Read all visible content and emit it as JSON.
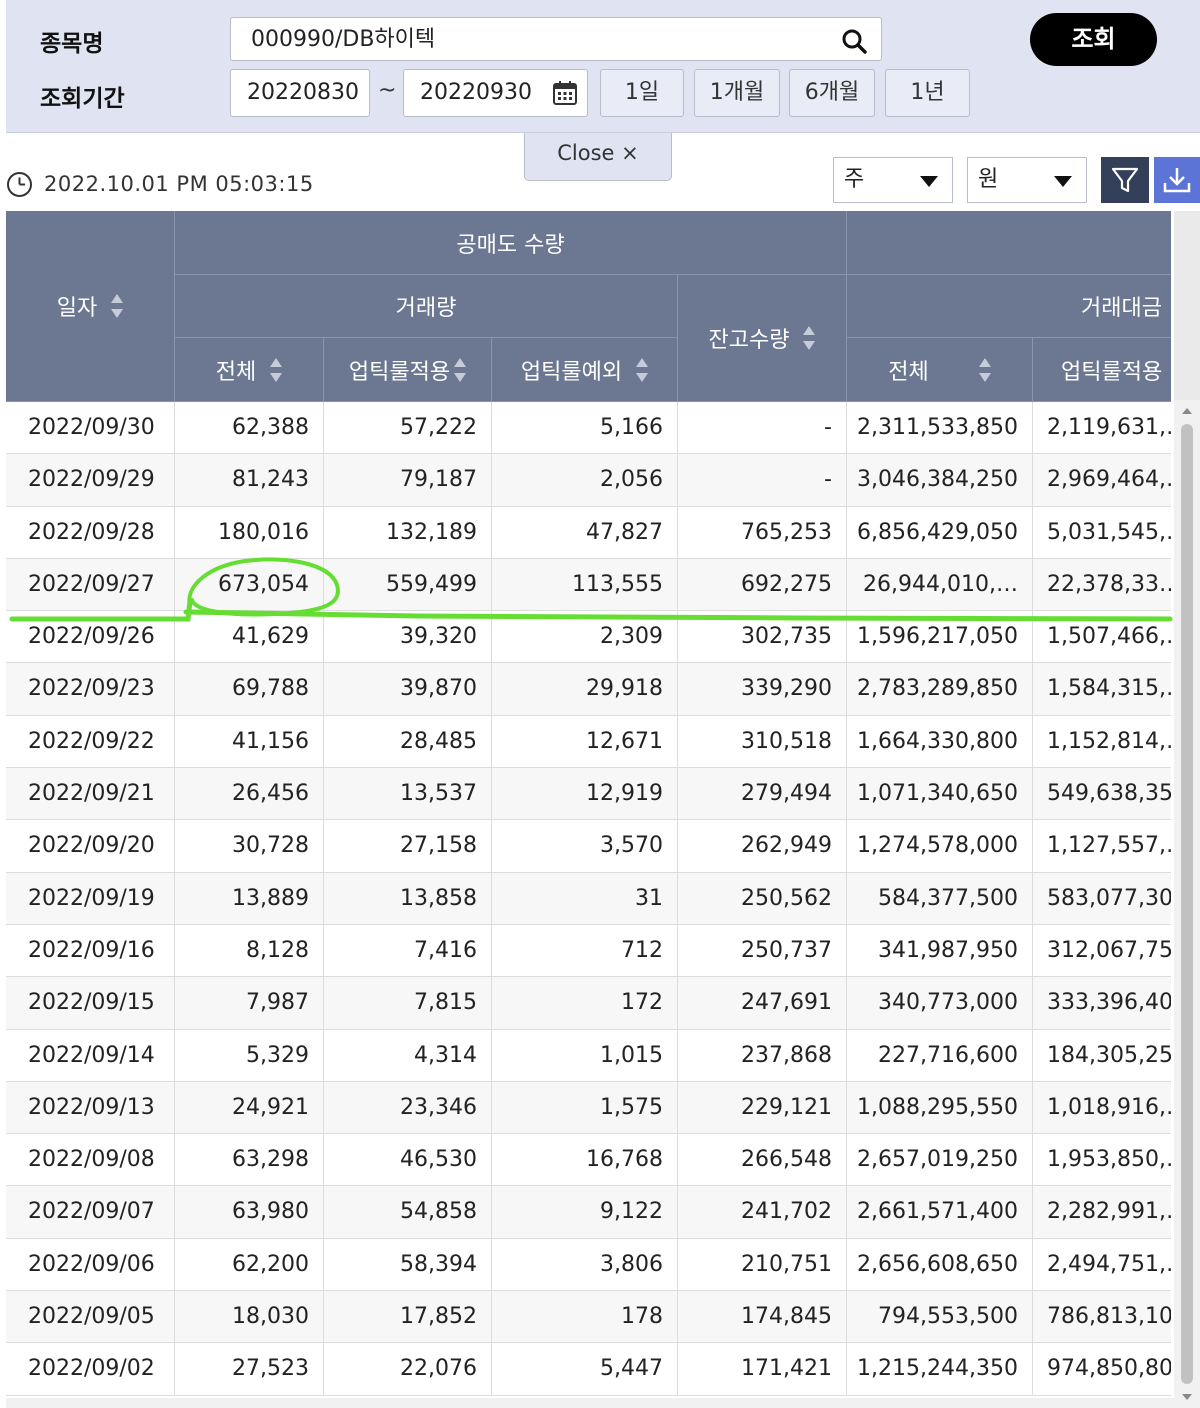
{
  "search": {
    "stock_label": "종목명",
    "period_label": "조회기간",
    "stock_value": "000990/DB하이텍",
    "date_from": "20220830",
    "date_to": "20220930",
    "tilde": "~",
    "period_buttons": [
      "1일",
      "1개월",
      "6개월",
      "1년"
    ],
    "query_button": "조회",
    "close_tab": "Close ×"
  },
  "toolbar": {
    "timestamp": "2022.10.01 PM 05:03:15",
    "unit_select": "주",
    "currency_select": "원"
  },
  "table": {
    "headers": {
      "date": "일자",
      "short_volume": "공매도 수량",
      "trade_volume": "거래량",
      "balance": "잔고수량",
      "trade_amount": "거래대금",
      "total": "전체",
      "uptick_applied": "업틱룰적용",
      "uptick_exempt": "업틱룰예외",
      "total2": "전체",
      "uptick_applied2": "업틱룰적용"
    },
    "rows": [
      [
        "2022/09/30",
        "62,388",
        "57,222",
        "5,166",
        "-",
        "2,311,533,850",
        "2,119,631,…"
      ],
      [
        "2022/09/29",
        "81,243",
        "79,187",
        "2,056",
        "-",
        "3,046,384,250",
        "2,969,464,…"
      ],
      [
        "2022/09/28",
        "180,016",
        "132,189",
        "47,827",
        "765,253",
        "6,856,429,050",
        "5,031,545,…"
      ],
      [
        "2022/09/27",
        "673,054",
        "559,499",
        "113,555",
        "692,275",
        "26,944,010,…",
        "22,378,33…"
      ],
      [
        "2022/09/26",
        "41,629",
        "39,320",
        "2,309",
        "302,735",
        "1,596,217,050",
        "1,507,466,…"
      ],
      [
        "2022/09/23",
        "69,788",
        "39,870",
        "29,918",
        "339,290",
        "2,783,289,850",
        "1,584,315,…"
      ],
      [
        "2022/09/22",
        "41,156",
        "28,485",
        "12,671",
        "310,518",
        "1,664,330,800",
        "1,152,814,…"
      ],
      [
        "2022/09/21",
        "26,456",
        "13,537",
        "12,919",
        "279,494",
        "1,071,340,650",
        "549,638,35"
      ],
      [
        "2022/09/20",
        "30,728",
        "27,158",
        "3,570",
        "262,949",
        "1,274,578,000",
        "1,127,557,…"
      ],
      [
        "2022/09/19",
        "13,889",
        "13,858",
        "31",
        "250,562",
        "584,377,500",
        "583,077,30"
      ],
      [
        "2022/09/16",
        "8,128",
        "7,416",
        "712",
        "250,737",
        "341,987,950",
        "312,067,75"
      ],
      [
        "2022/09/15",
        "7,987",
        "7,815",
        "172",
        "247,691",
        "340,773,000",
        "333,396,40"
      ],
      [
        "2022/09/14",
        "5,329",
        "4,314",
        "1,015",
        "237,868",
        "227,716,600",
        "184,305,25"
      ],
      [
        "2022/09/13",
        "24,921",
        "23,346",
        "1,575",
        "229,121",
        "1,088,295,550",
        "1,018,916,…"
      ],
      [
        "2022/09/08",
        "63,298",
        "46,530",
        "16,768",
        "266,548",
        "2,657,019,250",
        "1,953,850,…"
      ],
      [
        "2022/09/07",
        "63,980",
        "54,858",
        "9,122",
        "241,702",
        "2,661,571,400",
        "2,282,991,…"
      ],
      [
        "2022/09/06",
        "62,200",
        "58,394",
        "3,806",
        "210,751",
        "2,656,608,650",
        "2,494,751,…"
      ],
      [
        "2022/09/05",
        "18,030",
        "17,852",
        "178",
        "174,845",
        "794,553,500",
        "786,813,10"
      ],
      [
        "2022/09/02",
        "27,523",
        "22,076",
        "5,447",
        "171,421",
        "1,215,244,350",
        "974,850,80"
      ]
    ]
  },
  "colors": {
    "panel_bg": "#dfe3f2",
    "header_bg": "#6c7792",
    "annotation_green": "#66dd33",
    "filter_btn": "#34405a",
    "download_btn": "#5c74d6"
  },
  "icons": [
    "search-icon",
    "calendar-icon",
    "close-icon",
    "clock-icon",
    "filter-icon",
    "download-icon",
    "sort-icon",
    "dropdown-caret-icon"
  ]
}
